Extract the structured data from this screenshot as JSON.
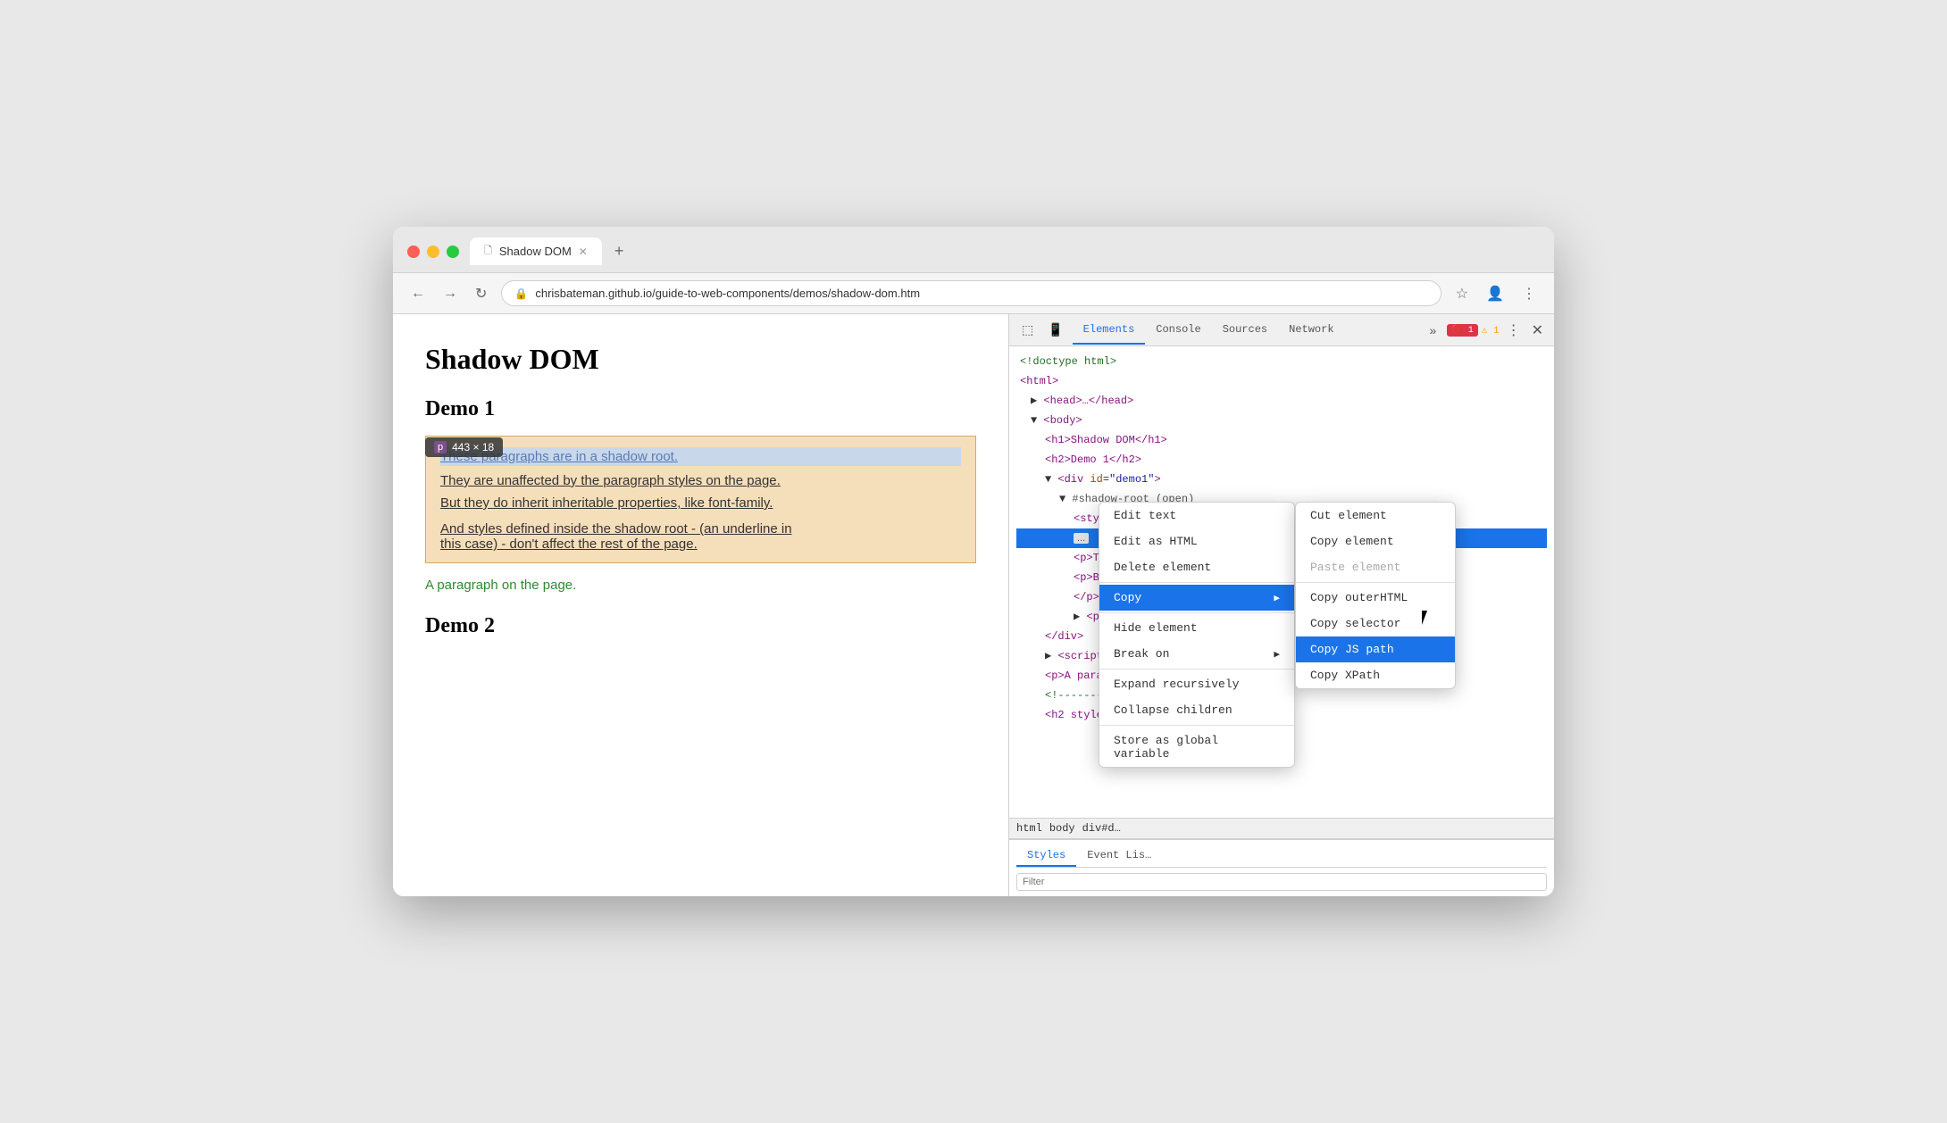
{
  "browser": {
    "tab_title": "Shadow DOM",
    "url": "chrisbateman.github.io/guide-to-web-components/demos/shadow-dom.htm",
    "url_display": "chrisbateman.github.io/guide-to-web-components/demos/shadow-dom.htm"
  },
  "page": {
    "title": "Shadow DOM",
    "demo1_label": "Demo 1",
    "tooltip": "443 × 18",
    "tooltip_p": "p",
    "para1": "These paragraphs are in a shadow root.",
    "para2": "They are unaffected by the paragraph styles on the page.",
    "para3": "But they do inherit inheritable properties, like font-family.",
    "para4_line1": "And styles defined inside the shadow root - (an underline in",
    "para4_line2": "this case) - don't affect the rest of the page.",
    "green_para": "A paragraph on the page.",
    "demo2_label": "Demo 2"
  },
  "devtools": {
    "tabs": [
      "Elements",
      "Console",
      "Sources",
      "Network"
    ],
    "active_tab": "Elements",
    "error_count": "1",
    "warn_count": "1",
    "dom": {
      "lines": [
        {
          "text": "<!doctype html>",
          "indent": 0
        },
        {
          "text": "<html>",
          "indent": 0
        },
        {
          "text": "▶ <head>…</head>",
          "indent": 1
        },
        {
          "text": "▼ <body>",
          "indent": 1
        },
        {
          "text": "<h1>Shadow DOM</h1>",
          "indent": 2
        },
        {
          "text": "<h2>Demo 1</h2>",
          "indent": 2
        },
        {
          "text": "▼ <div id=\"demo1\">",
          "indent": 2
        },
        {
          "text": "▼ #shadow-root (open)",
          "indent": 3
        },
        {
          "text": "<style>p {text-decoration: underline;}</style>",
          "indent": 4
        },
        {
          "text": "... <p>These…shadow root.</p> == $0",
          "indent": 4,
          "selected": true
        },
        {
          "text": "<p>They … aph styles on the page.</p>",
          "indent": 4
        },
        {
          "text": "<p>But … roperties, like font-family.",
          "indent": 4
        },
        {
          "text": "</p>",
          "indent": 4
        },
        {
          "text": "▶ <p>…</p>",
          "indent": 4
        },
        {
          "text": "</div>",
          "indent": 2
        },
        {
          "text": "▶ <script>…</",
          "indent": 2
        },
        {
          "text": "<p>A paragr",
          "indent": 2
        },
        {
          "text": "<!--------",
          "indent": 2
        },
        {
          "text": "<h2 style=\"",
          "indent": 2
        }
      ]
    },
    "breadcrumb": [
      "html",
      "body",
      "div#d…"
    ],
    "styles_tabs": [
      "Styles",
      "Event Lis…"
    ],
    "filter_placeholder": "Filter"
  },
  "context_menu": {
    "items": [
      {
        "label": "Edit text",
        "type": "item"
      },
      {
        "label": "Edit as HTML",
        "type": "item"
      },
      {
        "label": "Delete element",
        "type": "item"
      },
      {
        "label": "Copy",
        "type": "submenu"
      },
      {
        "label": "Hide element",
        "type": "item"
      },
      {
        "label": "Break on",
        "type": "submenu"
      },
      {
        "label": "Expand recursively",
        "type": "item"
      },
      {
        "label": "Collapse children",
        "type": "item"
      },
      {
        "label": "Store as global variable",
        "type": "item"
      }
    ],
    "submenu_items": [
      {
        "label": "Cut element"
      },
      {
        "label": "Copy element"
      },
      {
        "label": "Paste element",
        "disabled": true
      },
      {
        "label": "Copy outerHTML"
      },
      {
        "label": "Copy selector"
      },
      {
        "label": "Copy JS path",
        "highlighted": true
      },
      {
        "label": "Copy XPath"
      }
    ]
  }
}
